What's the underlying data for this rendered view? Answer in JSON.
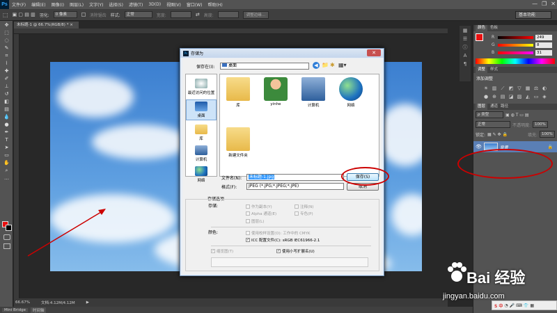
{
  "app": {
    "logo": "Ps"
  },
  "menu": [
    "文件(F)",
    "编辑(E)",
    "图像(I)",
    "图层(L)",
    "文字(Y)",
    "选择(S)",
    "滤镜(T)",
    "3D(D)",
    "视图(V)",
    "窗口(W)",
    "帮助(H)"
  ],
  "window_controls": {
    "minimize": "—",
    "restore": "❐",
    "close": "✕"
  },
  "options": {
    "feather_label": "羽化:",
    "feather_value": "0 像素",
    "antialias_label": "消除锯齿",
    "style_label": "样式:",
    "style_value": "正常",
    "width_label": "宽度:",
    "height_label": "高度:",
    "refine_label": "调整边缘...",
    "workspace": "基本功能"
  },
  "document": {
    "tab": "未标题-1 @ 66.7%(RGB/8) * ×",
    "zoom": "66.67%",
    "doc_size": "文档:4.12M/4.12M"
  },
  "bottom_tabs": [
    "Mini Bridge",
    "时间轴"
  ],
  "color_panel": {
    "tabs": [
      "颜色",
      "色板"
    ],
    "r_label": "R",
    "r_value": "249",
    "g_label": "G",
    "g_value": "8",
    "b_label": "B",
    "b_value": "31",
    "fg_color": "#e81010"
  },
  "adjust_panel": {
    "tabs": [
      "调整",
      "样式"
    ],
    "title": "添加调整"
  },
  "layers_panel": {
    "tabs": [
      "图层",
      "通道",
      "路径"
    ],
    "kind": "ρ 类型",
    "blend": "正常",
    "opacity_label": "不透明度:",
    "opacity_value": "100%",
    "lock_label": "锁定:",
    "fill_label": "填充:",
    "fill_value": "100%",
    "layer_name": "背景"
  },
  "dialog": {
    "title": "存储为",
    "save_in_label": "保存在(I):",
    "location": "桌面",
    "places": [
      "最近访问的位置",
      "桌面",
      "库",
      "计算机",
      "网络"
    ],
    "files": [
      "库",
      "yinhe",
      "计算机",
      "网络",
      "新建文件夹"
    ],
    "filename_label": "文件名(N):",
    "filename_value": "未标题-1.jpg",
    "format_label": "格式(F):",
    "format_value": "JPEG (*.JPG;*.JPEG;*.JPE)",
    "save_button": "保存(S)",
    "cancel_button": "取消",
    "options_title": "存储选项",
    "storage_label": "存储:",
    "as_copy": "作为副本(Y)",
    "notes": "注释(N)",
    "alpha": "Alpha 通道(E)",
    "spot": "专色(P)",
    "layers": "图层(L)",
    "color_label": "颜色:",
    "proof": "使用校样设置(O): 工作中的 CMYK",
    "icc": "ICC 配置文件(C): sRGB IEC61966-2.1",
    "thumbnail": "缩览图(T)",
    "lowercase": "使用小写扩展名(U)"
  },
  "watermark": {
    "text": "Bai 经验",
    "url": "jingyan.baidu.com"
  },
  "taskbar": {
    "ime": "S 中"
  }
}
